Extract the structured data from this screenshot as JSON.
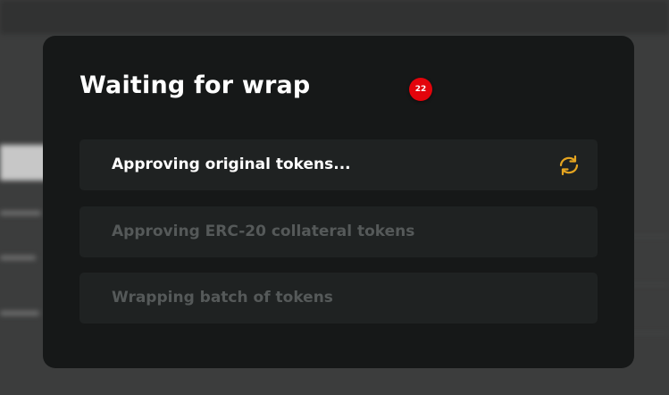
{
  "modal": {
    "title": "Waiting for wrap",
    "badge_count": "22",
    "steps": [
      {
        "label": "Approving original tokens...",
        "state": "active",
        "icon": "refresh-icon"
      },
      {
        "label": "Approving ERC-20 collateral tokens",
        "state": "pending"
      },
      {
        "label": "Wrapping batch of tokens",
        "state": "pending"
      }
    ]
  },
  "colors": {
    "modal_bg": "#161818",
    "step_bg": "#1f2222",
    "active_text": "#ffffff",
    "pending_text": "#555959",
    "spinner": "#e5a520",
    "badge": "#e3040b"
  }
}
